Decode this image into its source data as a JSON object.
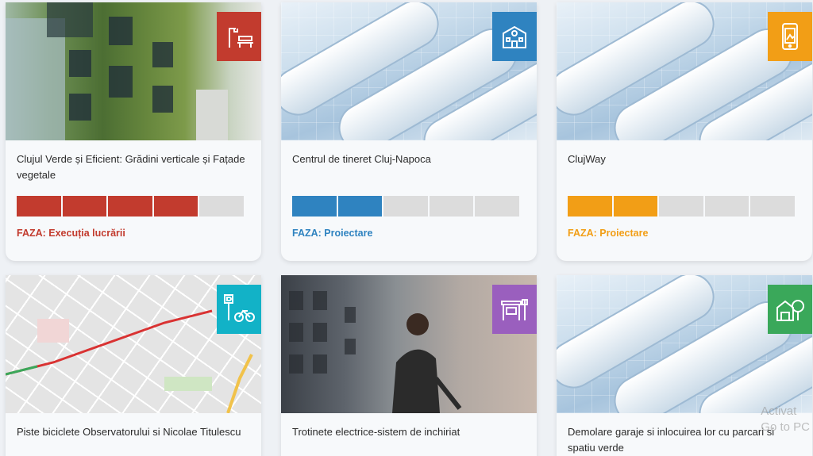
{
  "colors": {
    "red": "#c23b2e",
    "blue": "#2f83c0",
    "orange": "#f29e16",
    "cyan": "#12b2c7",
    "purple": "#9a5fbe",
    "green": "#3aa85a",
    "grey_segment": "#dcdcdc"
  },
  "cards": [
    {
      "title": "Clujul Verde și Eficient: Grădini verticale și Fațade vegetale",
      "icon": "park-bench-lamp-icon",
      "progress": 0.8,
      "phase": "FAZA: Execuția lucrării"
    },
    {
      "title": "Centrul de tineret Cluj-Napoca",
      "icon": "building-icon",
      "progress": 0.4,
      "phase": "FAZA: Proiectare"
    },
    {
      "title": "ClujWay",
      "icon": "mobile-map-icon",
      "progress": 0.4,
      "phase": "FAZA: Proiectare"
    },
    {
      "title": "Piste biciclete Observatorului si Nicolae Titulescu",
      "icon": "parking-bicycle-icon"
    },
    {
      "title": "Trotinete electrice-sistem de inchiriat",
      "icon": "bus-stop-icon"
    },
    {
      "title": "Demolare garaje si inlocuirea lor cu parcari si spatiu verde",
      "icon": "garage-tree-icon"
    }
  ],
  "watermark": {
    "line1": "Activat",
    "line2": "Go to PC"
  }
}
